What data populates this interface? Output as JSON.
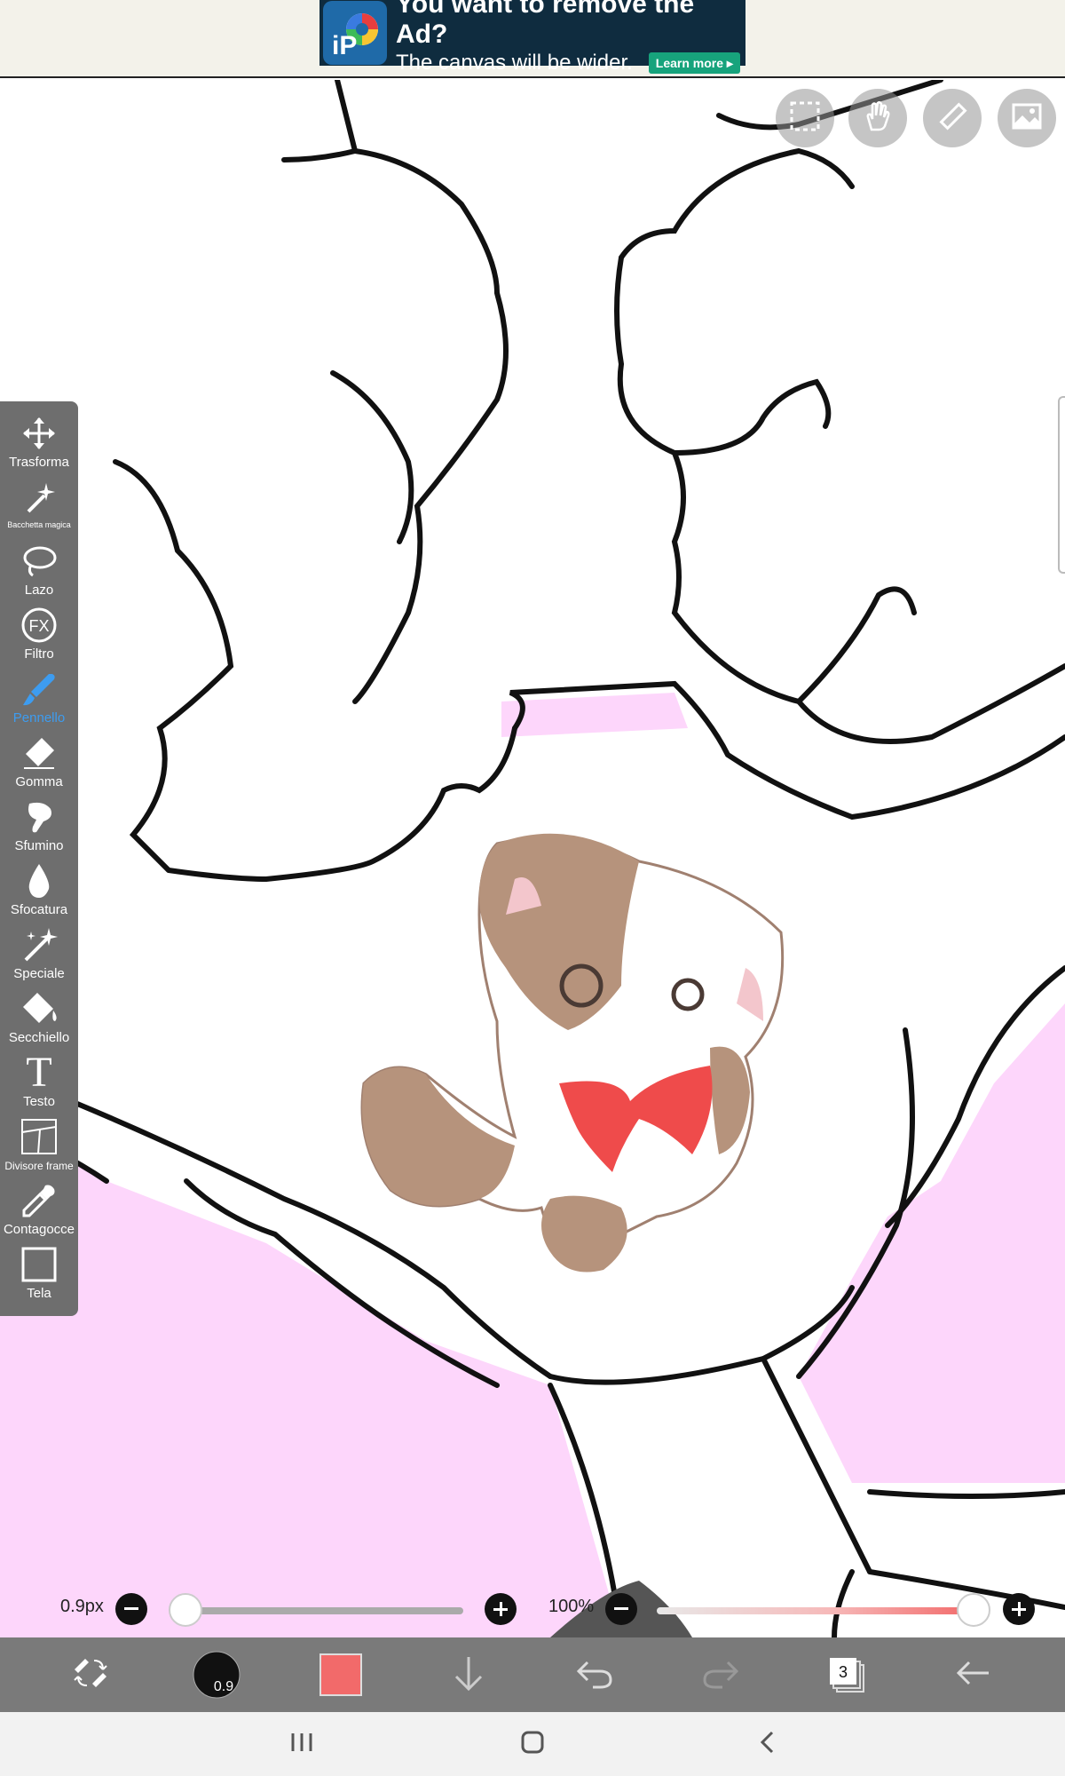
{
  "ad": {
    "title": "You want to remove the Ad?",
    "subtitle": "The canvas will be wider.",
    "cta": "Learn more ▸",
    "logo_text": "iP"
  },
  "toolbar": {
    "tools": [
      {
        "label": "Trasforma",
        "icon": "move-icon",
        "active": false
      },
      {
        "label": "Bacchetta magica",
        "icon": "magic-wand-icon",
        "active": false
      },
      {
        "label": "Lazo",
        "icon": "lasso-icon",
        "active": false
      },
      {
        "label": "Filtro",
        "icon": "fx-filter-icon",
        "active": false
      },
      {
        "label": "Pennello",
        "icon": "brush-icon",
        "active": true
      },
      {
        "label": "Gomma",
        "icon": "eraser-icon",
        "active": false
      },
      {
        "label": "Sfumino",
        "icon": "smudge-icon",
        "active": false
      },
      {
        "label": "Sfocatura",
        "icon": "blur-drop-icon",
        "active": false
      },
      {
        "label": "Speciale",
        "icon": "special-sparkle-icon",
        "active": false
      },
      {
        "label": "Secchiello",
        "icon": "bucket-icon",
        "active": false
      },
      {
        "label": "Testo",
        "icon": "text-icon",
        "active": false
      },
      {
        "label": "Divisore frame",
        "icon": "frame-divider-icon",
        "active": false
      },
      {
        "label": "Contagocce",
        "icon": "eyedropper-icon",
        "active": false
      },
      {
        "label": "Tela",
        "icon": "canvas-icon",
        "active": false
      }
    ],
    "fx_text": "FX",
    "text_glyph": "T"
  },
  "canvas_buttons": [
    "selection-icon",
    "hand-icon",
    "ruler-icon",
    "reference-image-icon"
  ],
  "brush_size": {
    "value_label": "0.9px",
    "level": 0.02
  },
  "opacity": {
    "value_label": "100%",
    "level": 1.0
  },
  "bottom_bar": {
    "brush_size_badge": "0.9",
    "layer_count": "3",
    "current_color": "#f26a6a"
  },
  "colors": {
    "accent": "#3d9cf0",
    "canvas_pink": "#fdd6fb",
    "toolbar_bg": "#6e6e6e"
  }
}
